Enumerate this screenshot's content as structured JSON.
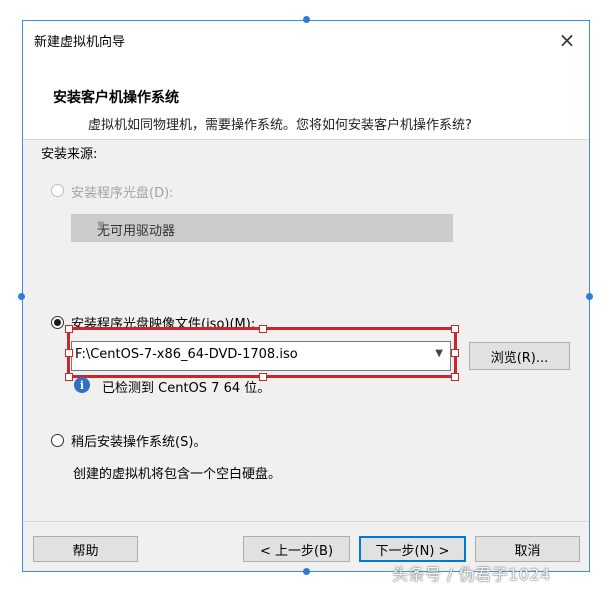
{
  "window": {
    "title": "新建虚拟机向导",
    "close_icon": "×"
  },
  "header": {
    "title": "安装客户机操作系统",
    "subtitle": "虚拟机如同物理机，需要操作系统。您将如何安装客户机操作系统?"
  },
  "install_source": {
    "label": "安装来源:",
    "disc_option": {
      "label": "安装程序光盘(D):",
      "enabled": false,
      "selected": false
    },
    "disc_combo": {
      "value": "无可用驱动器",
      "enabled": false
    },
    "iso_option": {
      "label": "安装程序光盘映像文件(iso)(M):",
      "selected": true
    },
    "iso_combo": {
      "value": "F:\\CentOS-7-x86_64-DVD-1708.iso"
    },
    "browse_label": "浏览(R)...",
    "detect_status": "已检测到 CentOS 7 64 位。",
    "later_option": {
      "label": "稍后安装操作系统(S)。",
      "selected": false
    },
    "later_note": "创建的虚拟机将包含一个空白硬盘。"
  },
  "footer": {
    "help": "帮助",
    "back": "< 上一步(B)",
    "next": "下一步(N) >",
    "cancel": "取消"
  },
  "watermark": "头条号 / 伪君子1024",
  "colors": {
    "highlight": "#c8282d",
    "accent": "#0078d7",
    "frame": "#2f7ad6"
  }
}
